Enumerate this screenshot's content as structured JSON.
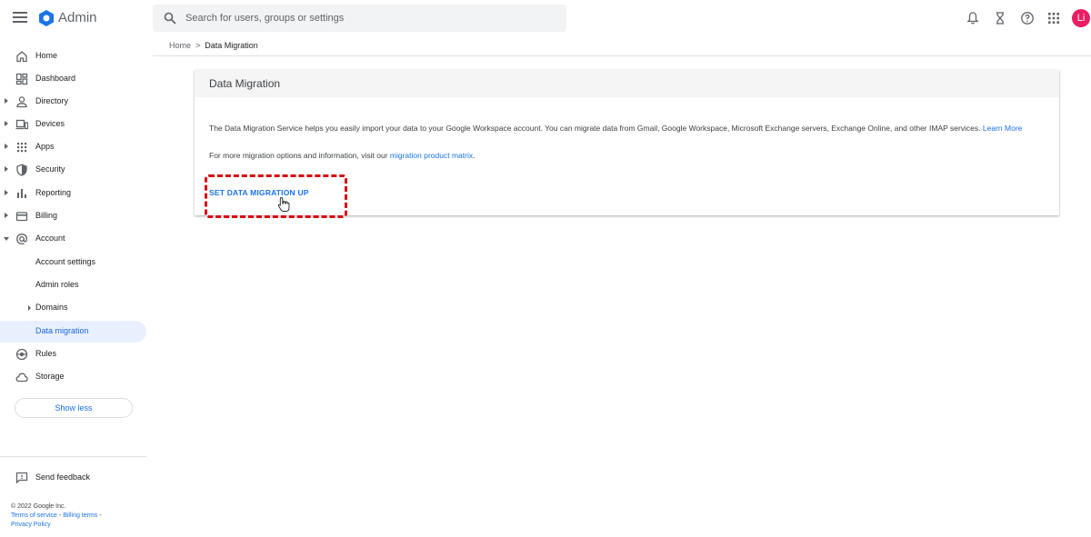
{
  "header": {
    "app_title": "Admin",
    "search_placeholder": "Search for users, groups or settings",
    "avatar_initials": "Li",
    "avatar_color": "#e91e63",
    "brand_color": "#1a73e8",
    "icons": [
      "menu-icon",
      "admin-logo-icon",
      "search-icon",
      "bell-icon",
      "hourglass-icon",
      "help-icon",
      "apps-grid-icon"
    ]
  },
  "sidebar": {
    "items": [
      {
        "label": "Home",
        "icon": "home-icon"
      },
      {
        "label": "Dashboard",
        "icon": "dashboard-icon"
      },
      {
        "label": "Directory",
        "icon": "person-icon"
      },
      {
        "label": "Devices",
        "icon": "devices-icon"
      },
      {
        "label": "Apps",
        "icon": "apps-grid-icon"
      },
      {
        "label": "Security",
        "icon": "shield-icon"
      },
      {
        "label": "Reporting",
        "icon": "bar-chart-icon"
      },
      {
        "label": "Billing",
        "icon": "credit-card-icon"
      },
      {
        "label": "Account",
        "icon": "at-sign-icon"
      }
    ],
    "account_sub": [
      {
        "label": "Account settings"
      },
      {
        "label": "Admin roles"
      },
      {
        "label": "Domains"
      },
      {
        "label": "Data migration"
      }
    ],
    "items_after": [
      {
        "label": "Rules",
        "icon": "rules-icon"
      },
      {
        "label": "Storage",
        "icon": "cloud-icon"
      }
    ],
    "show_less": "Show less",
    "feedback": "Send feedback",
    "footer": {
      "copyright": "© 2022 Google Inc.",
      "terms": "Terms of service",
      "billing_terms": "Billing terms",
      "privacy": "Privacy Policy"
    }
  },
  "breadcrumb": {
    "home": "Home",
    "separator": ">",
    "current": "Data Migration"
  },
  "card": {
    "title": "Data Migration",
    "description": "The Data Migration Service helps you easily import your data to your Google Workspace account. You can migrate data from Gmail, Google Workspace, Microsoft Exchange servers, Exchange Online, and other IMAP services.",
    "learn_more": "Learn More",
    "more_info_prefix": "For more migration options and information, visit our",
    "more_info_link": "migration product matrix",
    "more_info_suffix": ".",
    "setup_button": "SET DATA MIGRATION UP"
  }
}
